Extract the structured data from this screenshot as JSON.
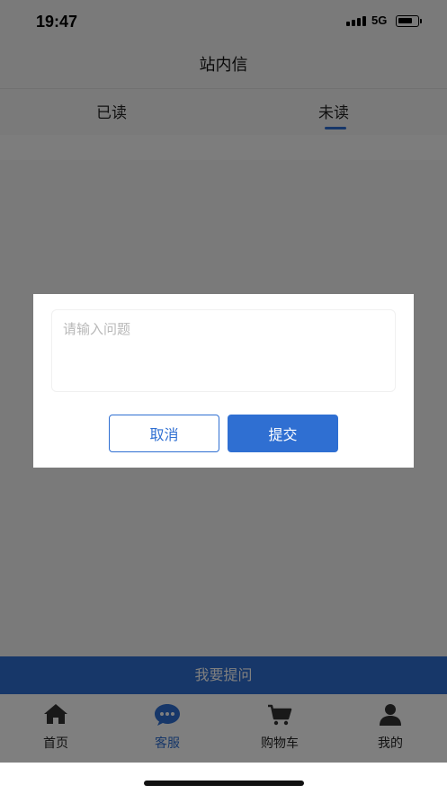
{
  "status_bar": {
    "time": "19:47",
    "network": "5G"
  },
  "nav": {
    "title": "站内信"
  },
  "tabs": [
    {
      "label": "已读",
      "active": false
    },
    {
      "label": "未读",
      "active": true
    }
  ],
  "ask_button": {
    "label": "我要提问"
  },
  "tabbar": {
    "items": [
      {
        "label": "首页",
        "icon": "home-icon",
        "active": false
      },
      {
        "label": "客服",
        "icon": "chat-icon",
        "active": true
      },
      {
        "label": "购物车",
        "icon": "cart-icon",
        "active": false
      },
      {
        "label": "我的",
        "icon": "user-icon",
        "active": false
      }
    ]
  },
  "dialog": {
    "input": {
      "value": "",
      "placeholder": "请输入问题"
    },
    "cancel_label": "取消",
    "submit_label": "提交"
  },
  "colors": {
    "accent": "#2f6fd2",
    "overlay": "rgba(0,0,0,0.5)"
  }
}
